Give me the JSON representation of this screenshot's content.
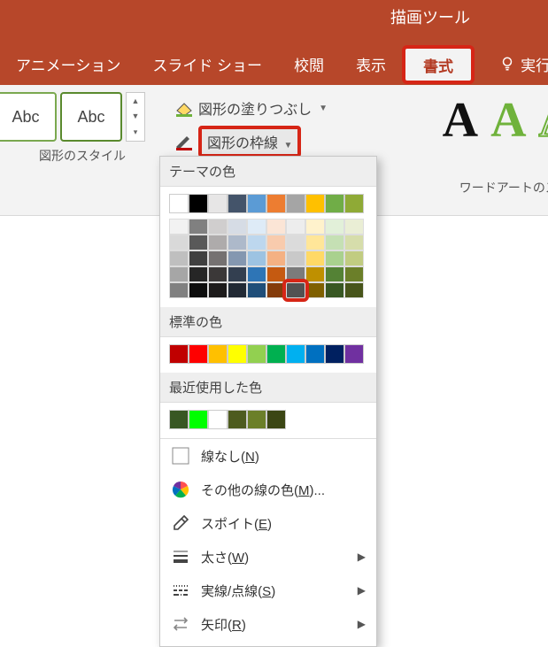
{
  "title_context": "描画ツール",
  "tabs": {
    "animation": "アニメーション",
    "slideshow": "スライド ショー",
    "review": "校閲",
    "view": "表示",
    "format": "書式",
    "tellme": "実行し"
  },
  "ribbon": {
    "shape_styles_label": "図形のスタイル",
    "sample_text": "Abc",
    "shape_fill": "図形の塗りつぶし",
    "shape_outline": "図形の枠線",
    "wordart_label": "ワードアートのス"
  },
  "panel": {
    "theme_title": "テーマの色",
    "standard_title": "標準の色",
    "recent_title": "最近使用した色",
    "theme_main": [
      "#ffffff",
      "#000000",
      "#e7e6e6",
      "#44546a",
      "#5b9bd5",
      "#ed7d31",
      "#a5a5a5",
      "#ffc000",
      "#70ad47",
      "#8faa36"
    ],
    "theme_tints": [
      [
        "#f2f2f2",
        "#d9d9d9",
        "#bfbfbf",
        "#a6a6a6",
        "#808080"
      ],
      [
        "#808080",
        "#595959",
        "#404040",
        "#262626",
        "#0d0d0d"
      ],
      [
        "#d0cece",
        "#aeabab",
        "#757171",
        "#3b3838",
        "#1d1b1b"
      ],
      [
        "#d6dce5",
        "#adb9ca",
        "#8497b0",
        "#333f50",
        "#222a35"
      ],
      [
        "#deebf7",
        "#bdd7ee",
        "#9dc3e2",
        "#2e75b6",
        "#1f4e79"
      ],
      [
        "#fbe5d6",
        "#f8cbad",
        "#f4b183",
        "#c55a11",
        "#843c0b"
      ],
      [
        "#ededed",
        "#dbdbdb",
        "#c9c9c9",
        "#7b7b7b",
        "#525252"
      ],
      [
        "#fff2cc",
        "#ffe699",
        "#ffd966",
        "#bf9000",
        "#7f6000"
      ],
      [
        "#e2f0d9",
        "#c5e0b4",
        "#a9d18e",
        "#548235",
        "#385723"
      ],
      [
        "#eaeed5",
        "#d6ddab",
        "#c1cc81",
        "#6b7f29",
        "#48551b"
      ]
    ],
    "selected": {
      "col": 6,
      "row": 4
    },
    "standard": [
      "#c00000",
      "#ff0000",
      "#ffc000",
      "#ffff00",
      "#92d050",
      "#00b050",
      "#00b0f0",
      "#0070c0",
      "#002060",
      "#7030a0"
    ],
    "recent": [
      "#385723",
      "#00ff00",
      "#ffffff",
      "#4d5b1f",
      "#6b7f29",
      "#3b4614"
    ],
    "menu": {
      "no_line": "線なし(",
      "no_line_k": "N",
      "more": "その他の線の色(",
      "more_k": "M",
      "more_tail": ")...",
      "eyedrop": "スポイト(",
      "eyedrop_k": "E",
      "weight": "太さ(",
      "weight_k": "W",
      "dashes": "実線/点線(",
      "dashes_k": "S",
      "arrows": "矢印(",
      "arrows_k": "R",
      "close": ")"
    }
  }
}
